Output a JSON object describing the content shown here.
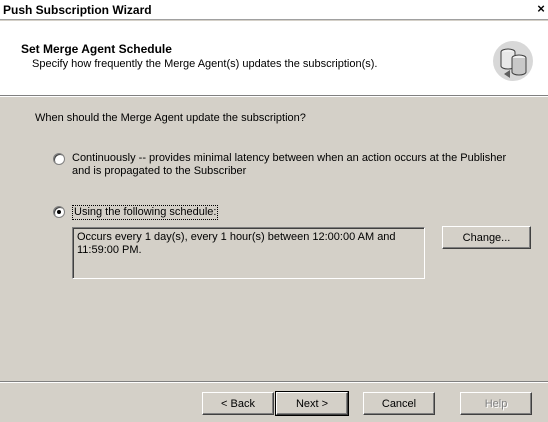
{
  "window": {
    "title": "Push Subscription Wizard",
    "close_glyph": "×"
  },
  "header": {
    "title": "Set Merge Agent Schedule",
    "subtitle": "Specify how frequently the Merge Agent(s) updates the subscription(s).",
    "icon": "database-subscription-icon"
  },
  "body": {
    "question": "When should the Merge Agent update the subscription?",
    "options": [
      {
        "line1": "Continuously -- provides minimal latency between when an action occurs at the Publisher",
        "line2": "and is propagated to the Subscriber",
        "selected": false
      },
      {
        "line1": "Using the following schedule:",
        "selected": true
      }
    ],
    "schedule_line1": "Occurs every 1 day(s), every 1 hour(s) between 12:00:00 AM and",
    "schedule_line2": "11:59:00 PM.",
    "change_label": "Change..."
  },
  "footer": {
    "back_label": "< Back",
    "next_label": "Next >",
    "cancel_label": "Cancel",
    "help_label": "Help"
  }
}
